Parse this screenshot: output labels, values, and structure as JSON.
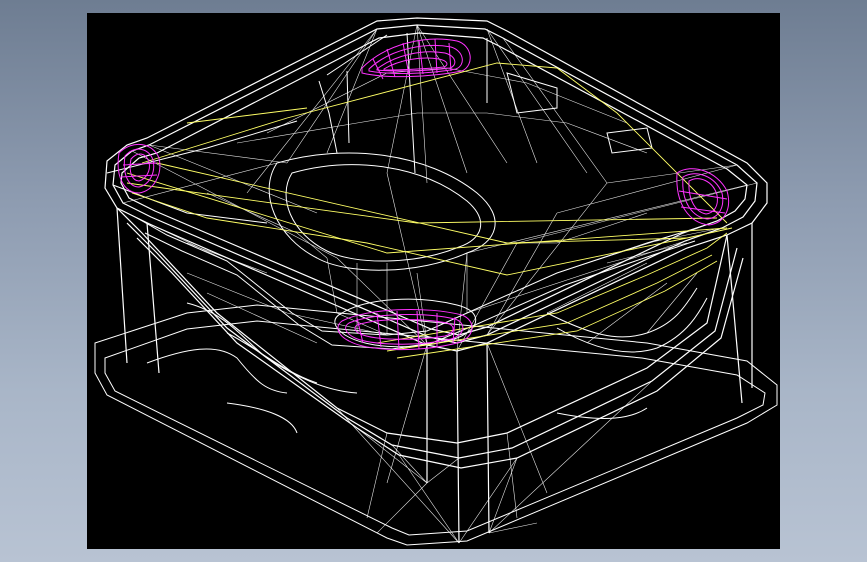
{
  "viewport": {
    "background": "#000000",
    "page_background_top": "#6e7d92",
    "page_background_bottom": "#b8c3d3"
  },
  "model": {
    "description_icon": "wireframe-bathtub-icon",
    "colors": {
      "wire": "#ffffff",
      "guide": "#ffff66",
      "headrest": "#ff33ff"
    }
  }
}
